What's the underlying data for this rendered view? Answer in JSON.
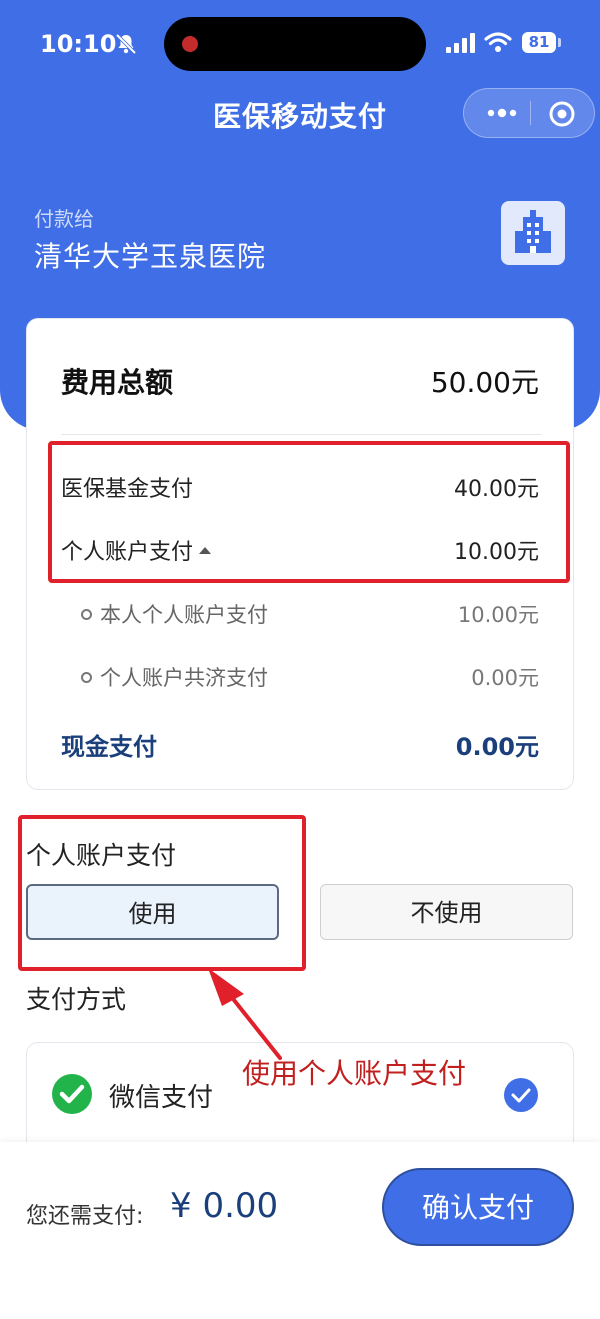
{
  "status_bar": {
    "time": "10:10",
    "battery": "81"
  },
  "nav": {
    "title": "医保移动支付"
  },
  "payee": {
    "label": "付款给",
    "name": "清华大学玉泉医院"
  },
  "fees": {
    "total_label": "费用总额",
    "total_value": "50.00元",
    "fund_label": "医保基金支付",
    "fund_value": "40.00元",
    "personal_label": "个人账户支付",
    "personal_value": "10.00元",
    "own_label": "本人个人账户支付",
    "own_value": "10.00元",
    "shared_label": "个人账户共济支付",
    "shared_value": "0.00元",
    "cash_label": "现金支付",
    "cash_value": "0.00元"
  },
  "personal_account": {
    "section_label": "个人账户支付",
    "use_label": "使用",
    "no_use_label": "不使用",
    "selected": "使用"
  },
  "payment_method": {
    "section_label": "支付方式",
    "wechat_label": "微信支付",
    "selected": true
  },
  "annotation": {
    "text": "使用个人账户支付",
    "color": "#c21f1f"
  },
  "footer": {
    "remaining_label": "您还需支付:",
    "remaining_value": "¥ 0.00",
    "confirm_label": "确认支付"
  },
  "colors": {
    "brand": "#3f6ee6",
    "highlight": "#e0202a",
    "accent_text": "#1a3f7a"
  }
}
